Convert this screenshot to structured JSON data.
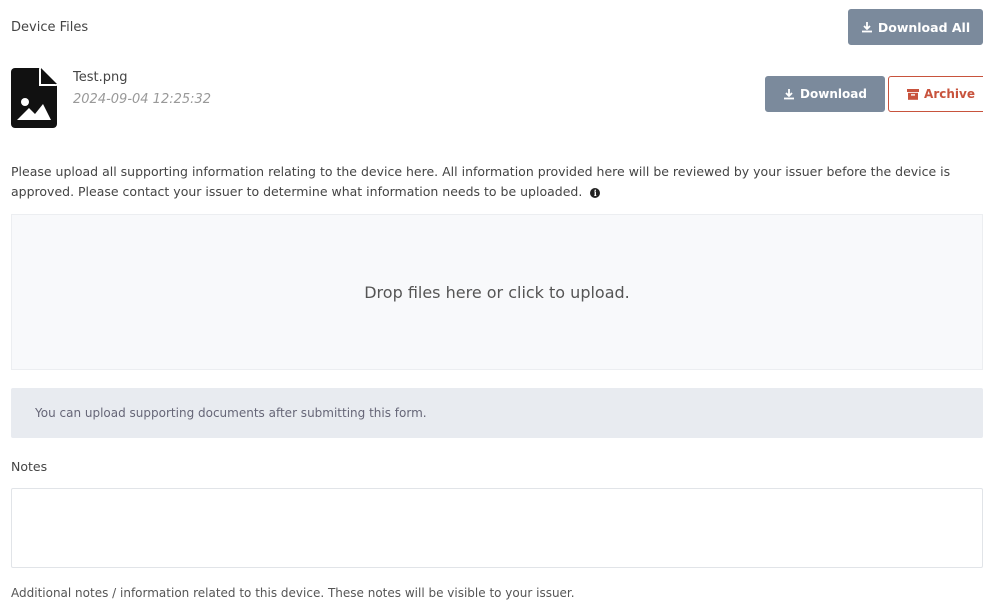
{
  "section": {
    "title": "Device Files",
    "download_all_label": "Download All"
  },
  "files": [
    {
      "name": "Test.png",
      "date": "2024-09-04 12:25:32",
      "download_label": "Download",
      "archive_label": "Archive",
      "icon": "file-image-icon"
    }
  ],
  "upload": {
    "info_text": "Please upload all supporting information relating to the device here. All information provided here will be reviewed by your issuer before the device is approved. Please contact your issuer to determine what information needs to be uploaded.",
    "dropzone_text": "Drop files here or click to upload.",
    "alert_text": "You can upload supporting documents after submitting this form."
  },
  "notes": {
    "label": "Notes",
    "value": "",
    "help_text": "Additional notes / information related to this device. These notes will be visible to your issuer."
  },
  "colors": {
    "gray_button": "#7b8a9c",
    "archive_red": "#c8533d",
    "alert_bg": "#e8ebf0"
  }
}
